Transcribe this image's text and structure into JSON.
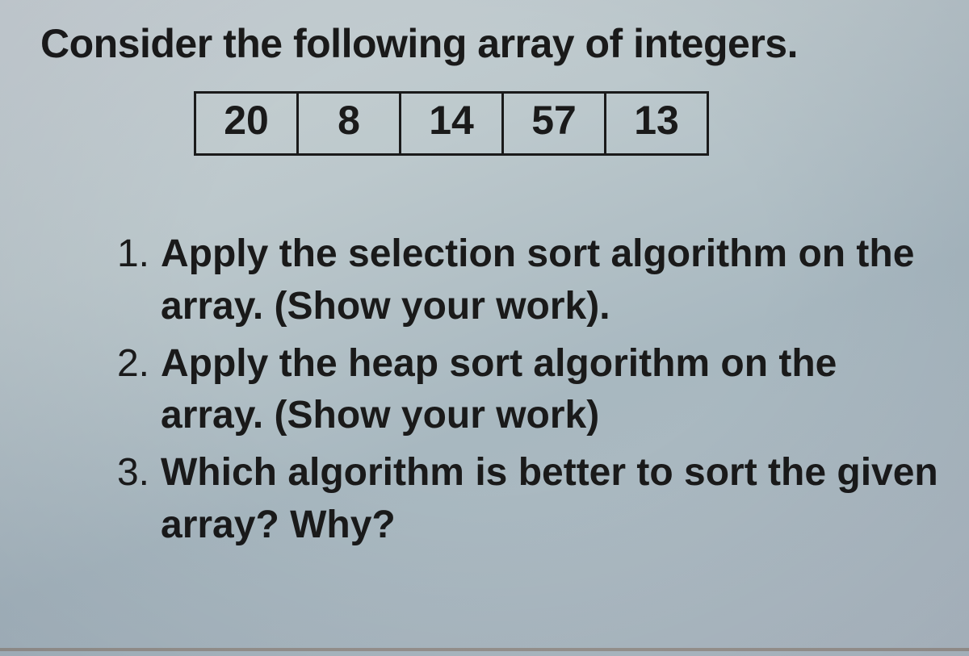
{
  "title": "Consider the following array of integers.",
  "array": [
    "20",
    "8",
    "14",
    "57",
    "13"
  ],
  "questions": [
    {
      "num": "1.",
      "text": "Apply the selection sort algorithm on the array. (Show your work)."
    },
    {
      "num": "2.",
      "text": "Apply the heap sort algorithm on the array. (Show your work)"
    },
    {
      "num": "3.",
      "text": "Which algorithm is better to sort the given array? Why?"
    }
  ]
}
